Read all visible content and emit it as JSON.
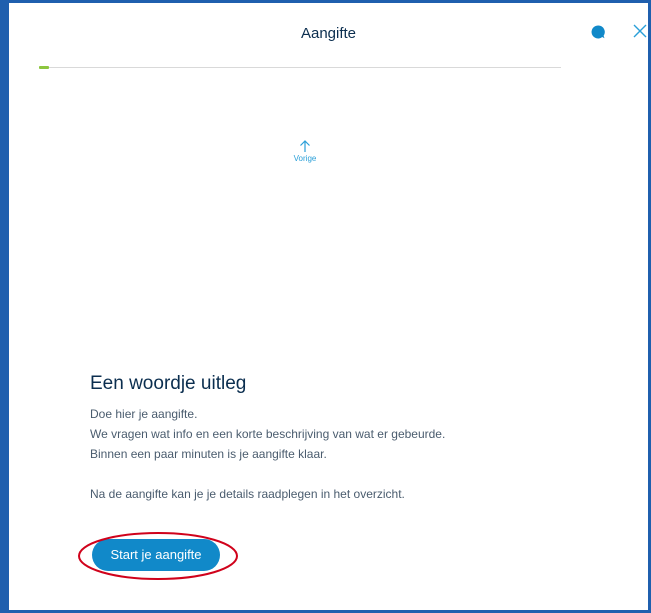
{
  "header": {
    "title": "Aangifte",
    "chat_icon": "chat-bubble-icon",
    "close_icon": "close-icon"
  },
  "progress": {
    "fraction": 0.02,
    "color": "#8dc63f"
  },
  "nav": {
    "previous_label": "Vorige",
    "previous_icon": "arrow-up-icon"
  },
  "content": {
    "heading": "Een woordje uitleg",
    "lines": [
      "Doe hier je aangifte.",
      "We vragen wat info en een korte beschrijving van wat er gebeurde.",
      "Binnen een paar minuten is je aangifte klaar."
    ],
    "note": "Na de aangifte kan je je details raadplegen in het overzicht."
  },
  "actions": {
    "start_label": "Start je aangifte"
  },
  "colors": {
    "frame": "#1f5fae",
    "accent": "#1189c9",
    "heading": "#0b2e4f",
    "annotation": "#d0021b"
  }
}
